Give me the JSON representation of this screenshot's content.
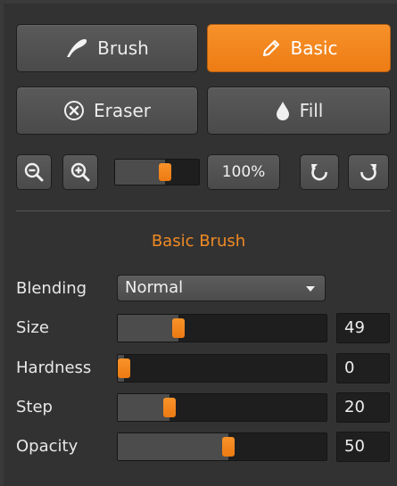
{
  "tools": {
    "brush_label": "Brush",
    "basic_label": "Basic",
    "eraser_label": "Eraser",
    "fill_label": "Fill"
  },
  "zoom": {
    "value_label": "100%",
    "slider_fraction": 0.6
  },
  "section_title": "Basic Brush",
  "blending": {
    "label": "Blending",
    "value": "Normal"
  },
  "settings": [
    {
      "label": "Size",
      "value": "49",
      "fraction": 0.26
    },
    {
      "label": "Hardness",
      "value": "0",
      "fraction": 0.0
    },
    {
      "label": "Step",
      "value": "20",
      "fraction": 0.22
    },
    {
      "label": "Opacity",
      "value": "50",
      "fraction": 0.5
    }
  ],
  "colors": {
    "accent": "#f08a24",
    "panel": "#323232",
    "button": "#505050"
  }
}
